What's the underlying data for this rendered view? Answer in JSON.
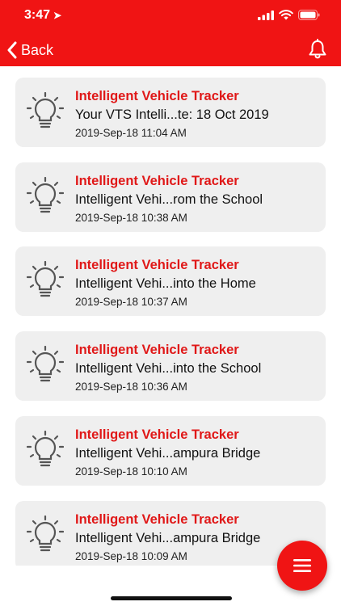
{
  "status_bar": {
    "time": "3:47",
    "location_icon": "location-arrow-icon",
    "signal_icon": "cellular-signal-icon",
    "wifi_icon": "wifi-icon",
    "battery_icon": "battery-icon"
  },
  "nav": {
    "back_label": "Back",
    "back_icon": "chevron-left-icon",
    "bell_icon": "bell-icon"
  },
  "colors": {
    "accent": "#f01414",
    "title_red": "#e01818",
    "card_bg": "#efefef"
  },
  "notifications": [
    {
      "title": "Intelligent Vehicle Tracker",
      "message": "Your VTS Intelli...te: 18 Oct 2019",
      "time": "2019-Sep-18 11:04 AM",
      "icon": "lightbulb-icon"
    },
    {
      "title": "Intelligent Vehicle Tracker",
      "message": "Intelligent Vehi...rom the School",
      "time": "2019-Sep-18 10:38 AM",
      "icon": "lightbulb-icon"
    },
    {
      "title": "Intelligent Vehicle Tracker",
      "message": "Intelligent Vehi...into the Home",
      "time": "2019-Sep-18 10:37 AM",
      "icon": "lightbulb-icon"
    },
    {
      "title": "Intelligent Vehicle Tracker",
      "message": "Intelligent Vehi...into the School",
      "time": "2019-Sep-18 10:36 AM",
      "icon": "lightbulb-icon"
    },
    {
      "title": "Intelligent Vehicle Tracker",
      "message": "Intelligent Vehi...ampura Bridge",
      "time": "2019-Sep-18 10:10 AM",
      "icon": "lightbulb-icon"
    },
    {
      "title": "Intelligent Vehicle Tracker",
      "message": "Intelligent Vehi...ampura Bridge",
      "time": "2019-Sep-18 10:09 AM",
      "icon": "lightbulb-icon"
    }
  ],
  "fab": {
    "icon": "menu-lines-icon"
  }
}
